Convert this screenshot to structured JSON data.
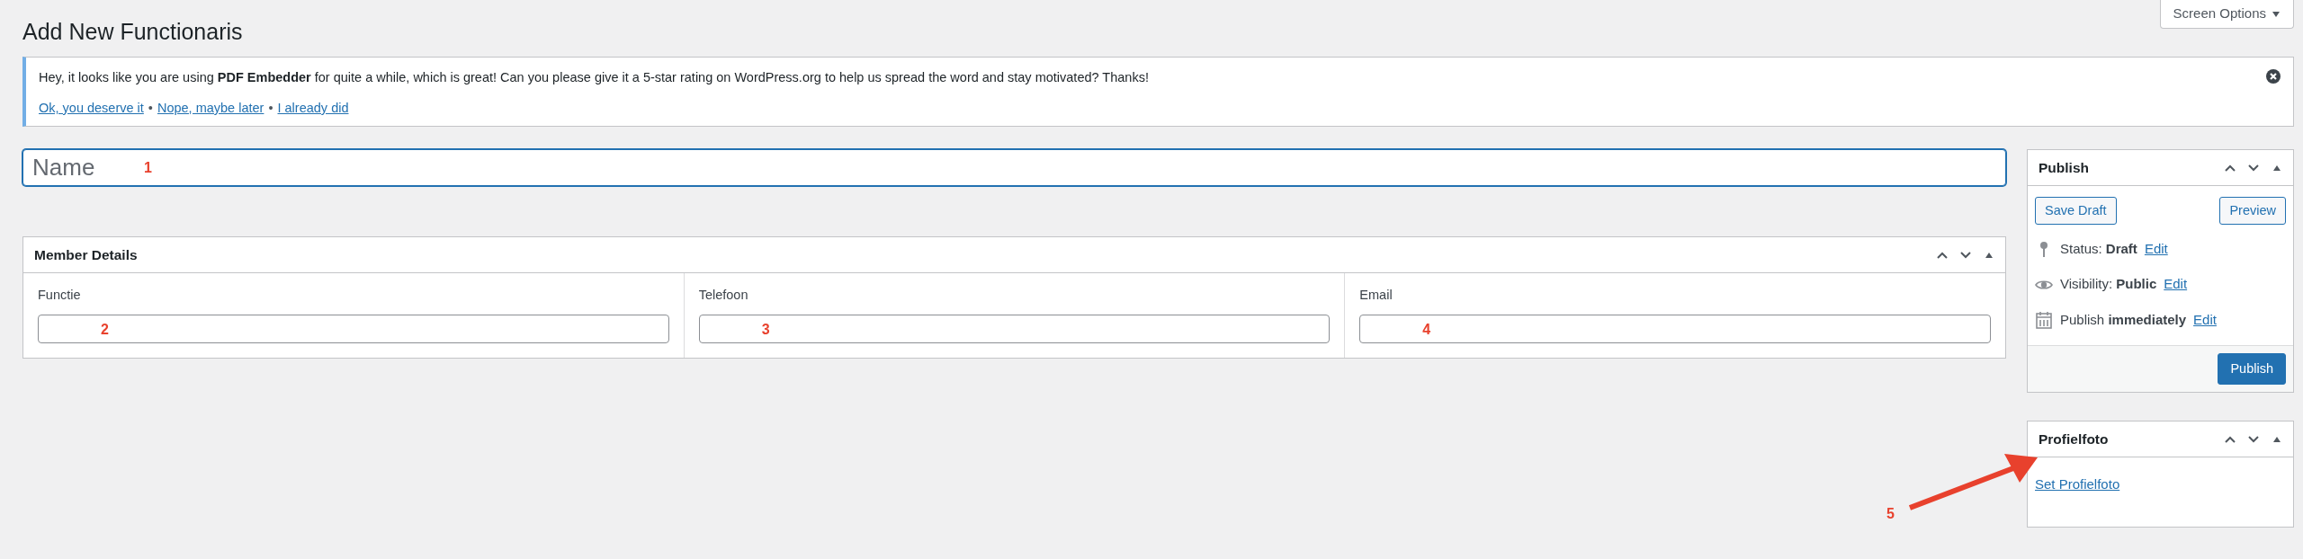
{
  "header": {
    "title": "Add New Functionaris",
    "screen_options": "Screen Options"
  },
  "notice": {
    "text": "Hey, it looks like you are using **PDF Embedder** for quite a while, which is great! Can you please give it a 5-star rating on WordPress.org to help us spread the word and stay motivated? Thanks!",
    "links": [
      "Ok, you deserve it",
      "Nope, maybe later",
      "I already did"
    ],
    "separators": [
      "•",
      "•"
    ]
  },
  "title_field": {
    "placeholder": "Name",
    "annotation": "1"
  },
  "member_details": {
    "title": "Member Details",
    "fields": [
      {
        "label": "Functie",
        "annotation": "2"
      },
      {
        "label": "Telefoon",
        "annotation": "3"
      },
      {
        "label": "Email",
        "annotation": "4"
      }
    ]
  },
  "publish": {
    "title": "Publish",
    "save_draft": "Save Draft",
    "preview": "Preview",
    "rows": [
      {
        "kind": "status",
        "text": "Status: **Draft**",
        "link": "Edit"
      },
      {
        "kind": "visibility",
        "text": "Visibility: **Public**",
        "link": "Edit"
      },
      {
        "kind": "schedule",
        "text": "Publish **immediately**",
        "link": "Edit"
      }
    ],
    "publish_button": "Publish"
  },
  "profielfoto": {
    "title": "Profielfoto",
    "link": "Set Profielfoto",
    "annotation": "5"
  }
}
